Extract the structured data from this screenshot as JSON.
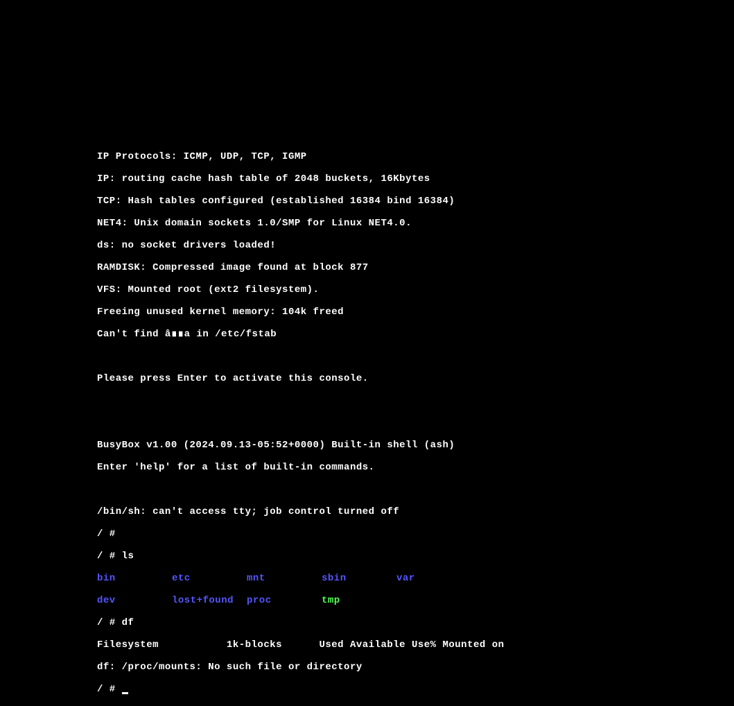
{
  "boot": {
    "l0": "IP Protocols: ICMP, UDP, TCP, IGMP",
    "l1": "IP: routing cache hash table of 2048 buckets, 16Kbytes",
    "l2": "TCP: Hash tables configured (established 16384 bind 16384)",
    "l3": "NET4: Unix domain sockets 1.0/SMP for Linux NET4.0.",
    "l4": "ds: no socket drivers loaded!",
    "l5": "RAMDISK: Compressed image found at block 877",
    "l6": "VFS: Mounted root (ext2 filesystem).",
    "l7": "Freeing unused kernel memory: 104k freed",
    "l8": "Can't find â∎∎a in /etc/fstab",
    "l9": "Please press Enter to activate this console."
  },
  "shell": {
    "banner": "BusyBox v1.00 (2024.09.13-05:52+0000) Built-in shell (ash)",
    "help": "Enter 'help' for a list of built-in commands.",
    "tty": "/bin/sh: can't access tty; job control turned off",
    "p0": "/ # ",
    "p1": "/ # ",
    "cmd1": "ls",
    "p2": "/ # ",
    "cmd2": "df",
    "p3": "/ # "
  },
  "ls": {
    "r0c0": "bin",
    "r0c1": "etc",
    "r0c2": "mnt",
    "r0c3": "sbin",
    "r0c4": "var",
    "r1c0": "dev",
    "r1c1": "lost+found",
    "r1c2": "proc",
    "r1c3": "tmp"
  },
  "df": {
    "header": "Filesystem           1k-blocks      Used Available Use% Mounted on",
    "err": "df: /proc/mounts: No such file or directory"
  }
}
